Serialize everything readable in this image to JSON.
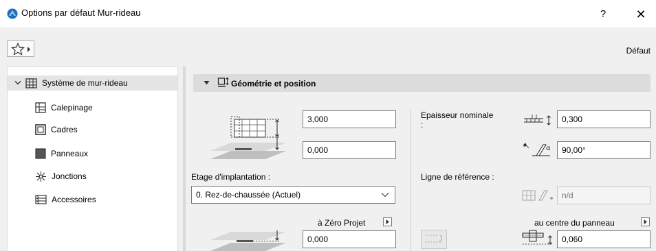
{
  "window": {
    "title": "Options par défaut Mur-rideau",
    "help_label": "?",
    "close_label": "✕"
  },
  "toolbar": {
    "default_label": "Défaut"
  },
  "tree": {
    "root_label": "Système de mur-rideau",
    "items": [
      {
        "label": "Calepinage",
        "icon": "grid-scheme-icon"
      },
      {
        "label": "Cadres",
        "icon": "frame-icon"
      },
      {
        "label": "Panneaux",
        "icon": "panel-icon"
      },
      {
        "label": "Jonctions",
        "icon": "junction-icon"
      },
      {
        "label": "Accessoires",
        "icon": "accessory-icon"
      }
    ]
  },
  "section": {
    "title": "Géométrie et position"
  },
  "geometry": {
    "height_value": "3,000",
    "offset_value": "0,000",
    "home_story_label": "Etage d'implantation :",
    "home_story_value": "0. Rez-de-chaussée (Actuel)",
    "relative_to_label": "à Zéro Projet",
    "elevation_value": "0,000"
  },
  "thickness": {
    "label": "Epaisseur nominale :",
    "value": "0,300",
    "angle_value": "90,00°",
    "reference_line_label": "Ligne de référence :",
    "reference_value": "n/d",
    "position_label": "au centre du panneau",
    "offset_value": "0,060"
  }
}
